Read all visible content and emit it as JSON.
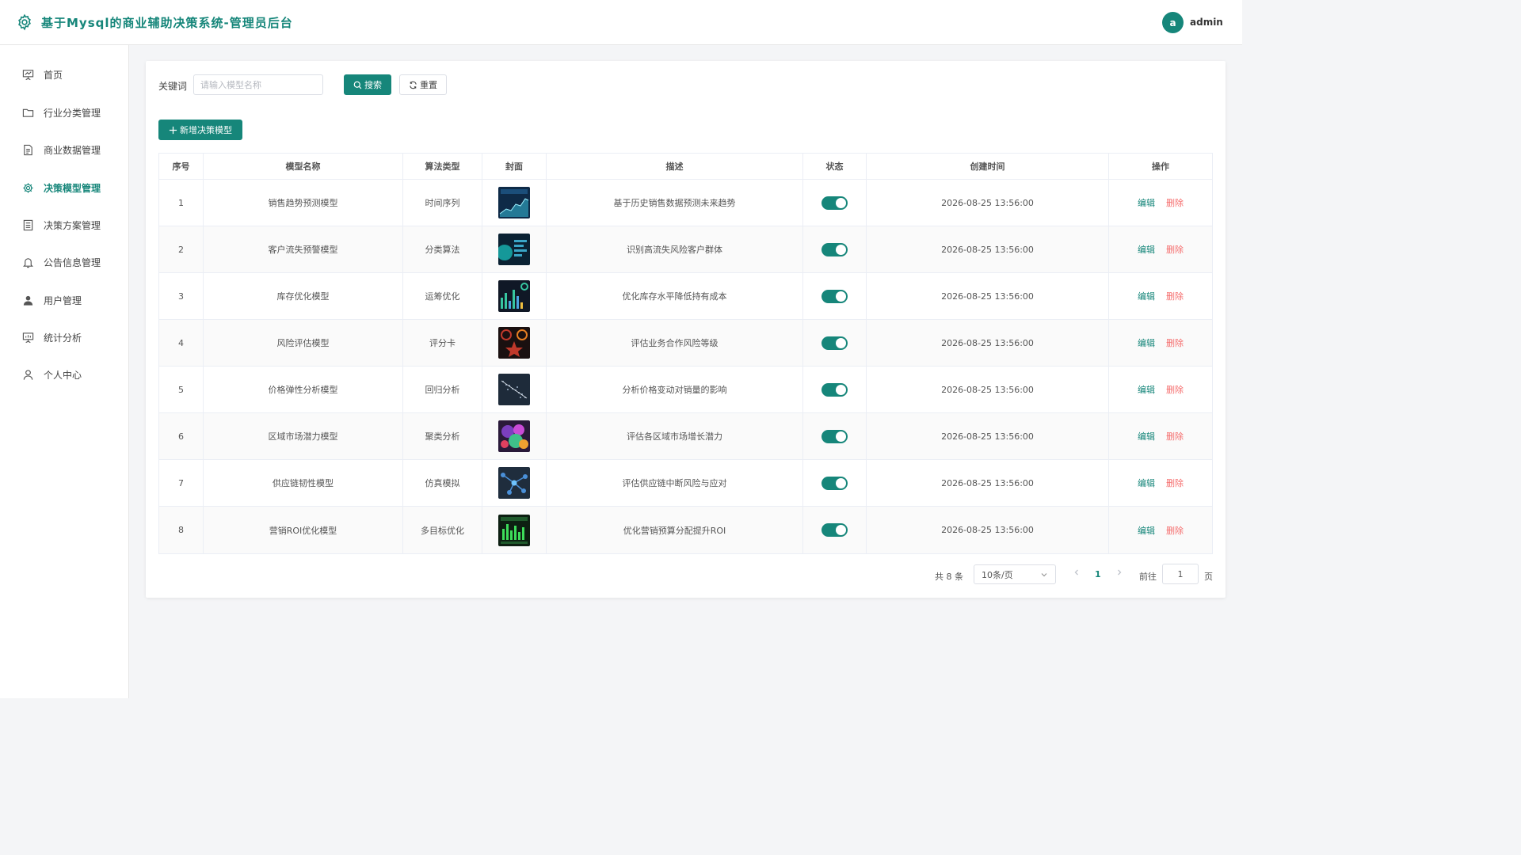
{
  "header": {
    "title": "基于Mysql的商业辅助决策系统-管理员后台",
    "avatar_letter": "a",
    "username": "admin",
    "logo_icon": "gear-icon"
  },
  "sidebar": {
    "items": [
      {
        "label": "首页",
        "icon": "presentation-icon",
        "active": false
      },
      {
        "label": "行业分类管理",
        "icon": "folder-icon",
        "active": false
      },
      {
        "label": "商业数据管理",
        "icon": "document-icon",
        "active": false
      },
      {
        "label": "决策模型管理",
        "icon": "cog-icon",
        "active": true
      },
      {
        "label": "决策方案管理",
        "icon": "list-document-icon",
        "active": false
      },
      {
        "label": "公告信息管理",
        "icon": "bell-icon",
        "active": false
      },
      {
        "label": "用户管理",
        "icon": "user-filled-icon",
        "active": false
      },
      {
        "label": "统计分析",
        "icon": "chart-board-icon",
        "active": false
      },
      {
        "label": "个人中心",
        "icon": "user-outline-icon",
        "active": false
      }
    ]
  },
  "search": {
    "label": "关键词",
    "placeholder": "请输入模型名称",
    "search_button": "搜索",
    "reset_button": "重置",
    "add_button": "新增决策模型"
  },
  "table": {
    "columns": [
      "序号",
      "模型名称",
      "算法类型",
      "封面",
      "描述",
      "状态",
      "创建时间",
      "操作"
    ],
    "edit_label": "编辑",
    "delete_label": "删除",
    "rows": [
      {
        "index": "1",
        "name": "销售趋势预测模型",
        "algorithm": "时间序列",
        "description": "基于历史销售数据预测未来趋势",
        "status_on": true,
        "created": "2026-08-25 13:56:00"
      },
      {
        "index": "2",
        "name": "客户流失预警模型",
        "algorithm": "分类算法",
        "description": "识别高流失风险客户群体",
        "status_on": true,
        "created": "2026-08-25 13:56:00"
      },
      {
        "index": "3",
        "name": "库存优化模型",
        "algorithm": "运筹优化",
        "description": "优化库存水平降低持有成本",
        "status_on": true,
        "created": "2026-08-25 13:56:00"
      },
      {
        "index": "4",
        "name": "风险评估模型",
        "algorithm": "评分卡",
        "description": "评估业务合作风险等级",
        "status_on": true,
        "created": "2026-08-25 13:56:00"
      },
      {
        "index": "5",
        "name": "价格弹性分析模型",
        "algorithm": "回归分析",
        "description": "分析价格变动对销量的影响",
        "status_on": true,
        "created": "2026-08-25 13:56:00"
      },
      {
        "index": "6",
        "name": "区域市场潜力模型",
        "algorithm": "聚类分析",
        "description": "评估各区域市场增长潜力",
        "status_on": true,
        "created": "2026-08-25 13:56:00"
      },
      {
        "index": "7",
        "name": "供应链韧性模型",
        "algorithm": "仿真模拟",
        "description": "评估供应链中断风险与应对",
        "status_on": true,
        "created": "2026-08-25 13:56:00"
      },
      {
        "index": "8",
        "name": "营销ROI优化模型",
        "algorithm": "多目标优化",
        "description": "优化营销预算分配提升ROI",
        "status_on": true,
        "created": "2026-08-25 13:56:00"
      }
    ]
  },
  "pagination": {
    "total_text": "共 8 条",
    "page_size": "10条/页",
    "current_page": "1",
    "goto_label": "前往",
    "goto_value": "1",
    "page_label": "页"
  },
  "colors": {
    "accent": "#16867a",
    "danger": "#f56c6c"
  }
}
